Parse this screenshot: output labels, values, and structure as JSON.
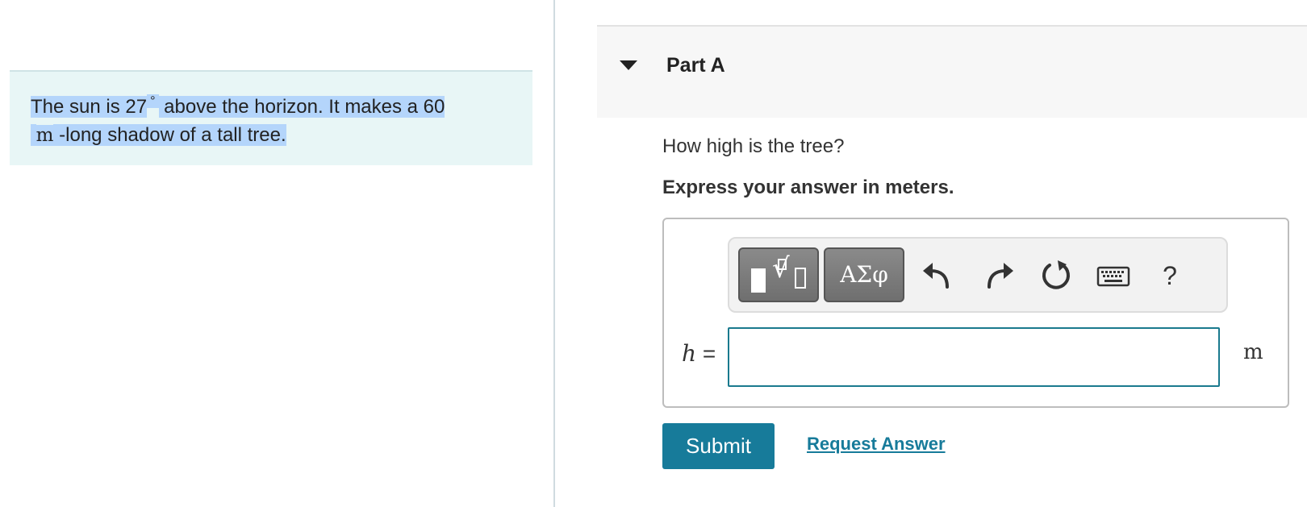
{
  "problem": {
    "text_before_angle": "The sun is 27",
    "angle_unit": "°",
    "text_after_angle": " above the horizon. It makes a 60",
    "length_unit": "m",
    "text_after_unit": " -long shadow of a tall tree."
  },
  "part": {
    "title": "Part A",
    "question": "How high is the tree?",
    "instruction": "Express your answer in meters."
  },
  "toolbar": {
    "greek_label": "ΑΣφ",
    "help_label": "?"
  },
  "answer": {
    "variable": "h",
    "equals": " =",
    "value": "",
    "unit": "m"
  },
  "actions": {
    "submit_label": "Submit",
    "request_label": "Request Answer"
  },
  "colors": {
    "accent": "#177b9a",
    "problem_bg": "#e8f6f6",
    "selection": "#b4d5fb"
  }
}
